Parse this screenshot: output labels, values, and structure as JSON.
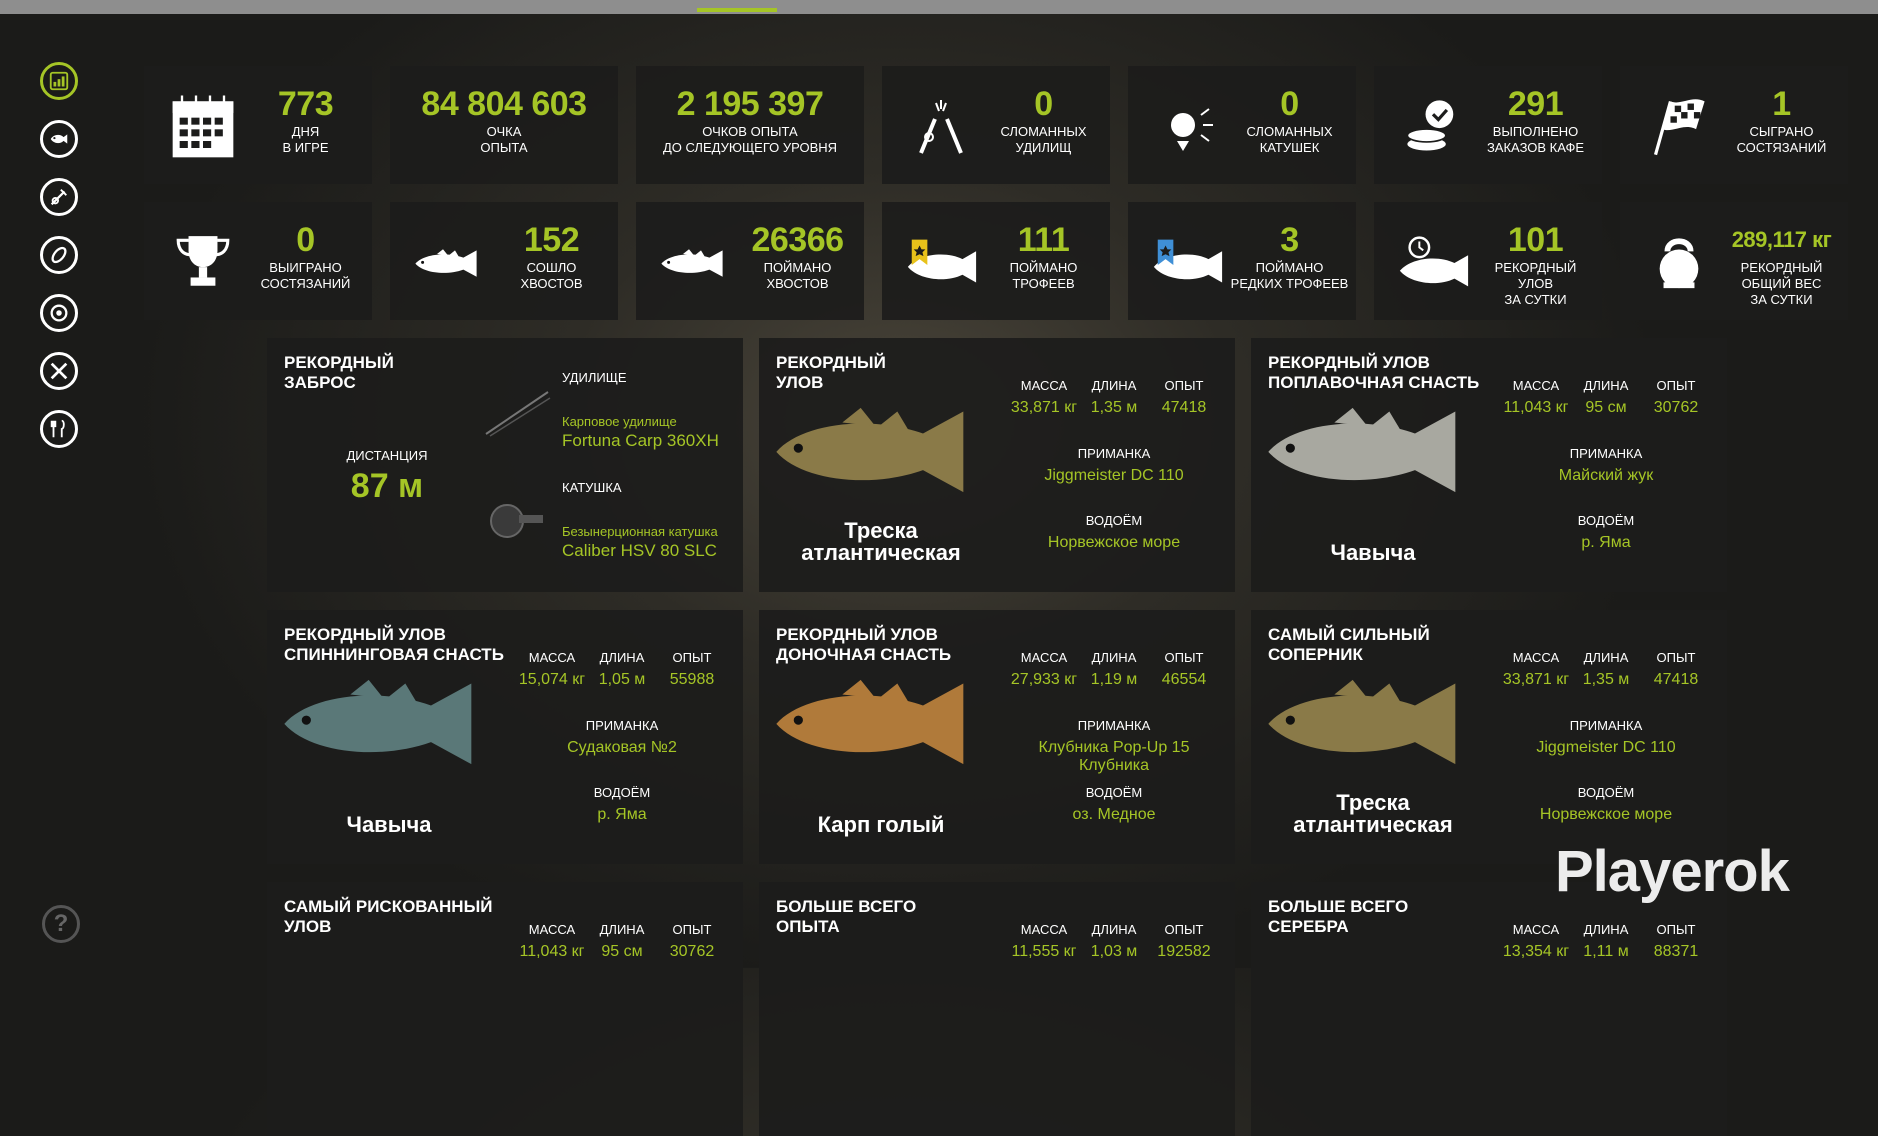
{
  "nav": {
    "items": [
      {
        "name": "stats",
        "active": true
      },
      {
        "name": "fish"
      },
      {
        "name": "tackle"
      },
      {
        "name": "lure"
      },
      {
        "name": "reel"
      },
      {
        "name": "tools"
      },
      {
        "name": "food"
      }
    ],
    "help": "?"
  },
  "colors": {
    "accent": "#a5c526",
    "panel": "#1c1c1b"
  },
  "stats_row1": [
    {
      "num": "773",
      "label": "ДНЯ\nВ ИГРЕ",
      "icon": "calendar-icon"
    },
    {
      "num": "84 804 603",
      "label": "ОЧКА\nОПЫТА",
      "icon": ""
    },
    {
      "num": "2 195 397",
      "label": "ОЧКОВ ОПЫТА\nДО СЛЕДУЮЩЕГО УРОВНЯ",
      "icon": ""
    },
    {
      "num": "0",
      "label": "СЛОМАННЫХ\nУДИЛИЩ",
      "icon": "broken-rod-icon"
    },
    {
      "num": "0",
      "label": "СЛОМАННЫХ\nКАТУШЕК",
      "icon": "broken-reel-icon"
    },
    {
      "num": "291",
      "label": "ВЫПОЛНЕНО\nЗАКАЗОВ КАФЕ",
      "icon": "coins-check-icon"
    },
    {
      "num": "1",
      "label": "СЫГРАНО\nСОСТЯЗАНИЙ",
      "icon": "checkered-flag-icon"
    }
  ],
  "stats_row2": [
    {
      "num": "0",
      "label": "ВЫИГРАНО\nСОСТЯЗАНИЙ",
      "icon": "trophy-icon"
    },
    {
      "num": "152",
      "label": "СОШЛО\nХВОСТОВ",
      "icon": "fish-icon"
    },
    {
      "num": "26366",
      "label": "ПОЙМАНО\nХВОСТОВ",
      "icon": "fish-icon"
    },
    {
      "num": "111",
      "label": "ПОЙМАНО\nТРОФЕЕВ",
      "icon": "trophy-fish-icon"
    },
    {
      "num": "3",
      "label": "ПОЙМАНО\nРЕДКИХ ТРОФЕЕВ",
      "icon": "rare-trophy-fish-icon"
    },
    {
      "num": "101",
      "label": "РЕКОРДНЫЙ\nУЛОВ\nЗА СУТКИ",
      "icon": "timer-fish-icon"
    },
    {
      "num": "289,117 кг",
      "label": "РЕКОРДНЫЙ\nОБЩИЙ ВЕС\nЗА СУТКИ",
      "icon": "kettlebell-icon"
    }
  ],
  "headers": {
    "mass": "МАССА",
    "length": "ДЛИНА",
    "exp": "ОПЫТ",
    "bait": "ПРИМАНКА",
    "water": "ВОДОЁМ"
  },
  "cast": {
    "title": "РЕКОРДНЫЙ\nЗАБРОС",
    "distance_label": "ДИСТАНЦИЯ",
    "distance": "87 м",
    "rod_label": "УДИЛИЩЕ",
    "rod_type": "Карповое удилище",
    "rod_name": "Fortuna Carp 360XH",
    "reel_label": "КАТУШКА",
    "reel_type": "Безынерционная катушка",
    "reel_name": "Caliber HSV 80 SLC"
  },
  "cards": [
    {
      "title": "РЕКОРДНЫЙ\nУЛОВ",
      "fish": "Треска\nатлантическая",
      "mass": "33,871 кг",
      "length": "1,35 м",
      "exp": "47418",
      "bait": "Jiggmeister DC 110",
      "water": "Норвежское море",
      "color": "#8a7a48"
    },
    {
      "title": "РЕКОРДНЫЙ УЛОВ\nПОПЛАВОЧНАЯ СНАСТЬ",
      "fish": "Чавыча",
      "mass": "11,043 кг",
      "length": "95 см",
      "exp": "30762",
      "bait": "Майский жук",
      "water": "р. Яма",
      "color": "#a8a8a0"
    },
    {
      "title": "РЕКОРДНЫЙ УЛОВ\nСПИННИНГОВАЯ СНАСТЬ",
      "fish": "Чавыча",
      "mass": "15,074 кг",
      "length": "1,05 м",
      "exp": "55988",
      "bait": "Судаковая №2",
      "water": "р. Яма",
      "color": "#5a7878"
    },
    {
      "title": "РЕКОРДНЫЙ УЛОВ\nДОНОЧНАЯ СНАСТЬ",
      "fish": "Карп голый",
      "mass": "27,933 кг",
      "length": "1,19 м",
      "exp": "46554",
      "bait": "Клубника Pop-Up 15\nКлубника",
      "water": "оз. Медное",
      "color": "#b07a3a"
    },
    {
      "title": "САМЫЙ СИЛЬНЫЙ\nСОПЕРНИК",
      "fish": "Треска\nатлантическая",
      "mass": "33,871 кг",
      "length": "1,35 м",
      "exp": "47418",
      "bait": "Jiggmeister DC 110",
      "water": "Норвежское море",
      "color": "#8a7a48"
    },
    {
      "title": "САМЫЙ РИСКОВАННЫЙ\nУЛОВ",
      "mass": "11,043 кг",
      "length": "95 см",
      "exp": "30762"
    },
    {
      "title": "БОЛЬШЕ ВСЕГО\nОПЫТА",
      "mass": "11,555 кг",
      "length": "1,03 м",
      "exp": "192582"
    },
    {
      "title": "БОЛЬШЕ ВСЕГО\nСЕРЕБРА",
      "mass": "13,354 кг",
      "length": "1,11 м",
      "exp": "88371"
    }
  ],
  "watermark": "Playerok"
}
